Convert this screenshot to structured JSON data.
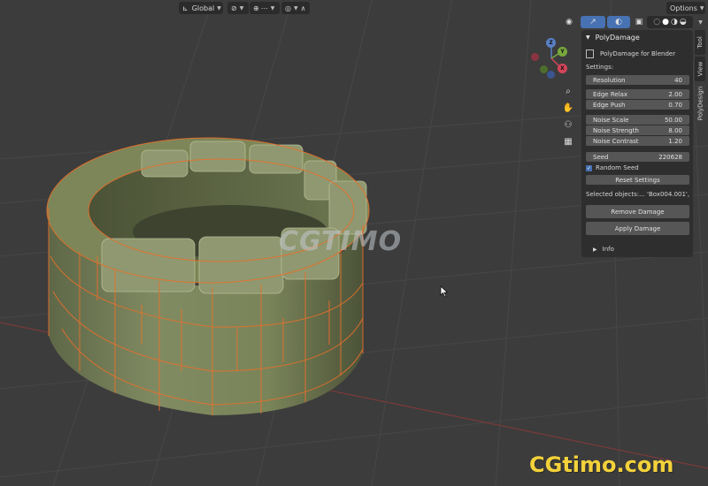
{
  "header": {
    "transform_orientation": "Global",
    "options_label": "Options"
  },
  "gizmo": {
    "z": "Z",
    "y": "Y",
    "x": "X"
  },
  "panel": {
    "title": "PolyDamage",
    "addon_name": "PolyDamage for Blender",
    "settings_label": "Settings:",
    "resolution": {
      "label": "Resolution",
      "value": "40"
    },
    "edge_relax": {
      "label": "Edge Relax",
      "value": "2.00"
    },
    "edge_push": {
      "label": "Edge Push",
      "value": "0.70"
    },
    "noise_scale": {
      "label": "Noise Scale",
      "value": "50.00"
    },
    "noise_strength": {
      "label": "Noise Strength",
      "value": "8.00"
    },
    "noise_contrast": {
      "label": "Noise Contrast",
      "value": "1.20"
    },
    "seed": {
      "label": "Seed",
      "value": "220628"
    },
    "random_seed_label": "Random Seed",
    "reset_label": "Reset Settings",
    "selected_objects": "Selected objects:... 'Box004.001', 'B",
    "remove_label": "Remove Damage",
    "apply_label": "Apply Damage",
    "info_label": "Info"
  },
  "side_tabs": {
    "tool": "Tool",
    "view": "View",
    "polydesign": "PolyDesign"
  },
  "watermark_center": "CGTIMO",
  "watermark_corner": "CGtimo.com"
}
